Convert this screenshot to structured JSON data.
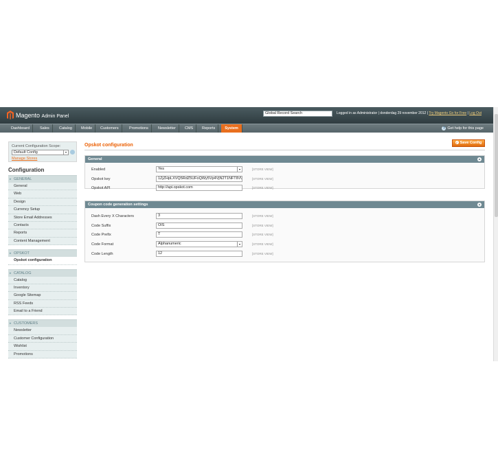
{
  "header": {
    "logo_text": "Magento",
    "panel_text": "Admin Panel",
    "search_value": "Global Record Search",
    "logged_in": "Logged in as Administrator",
    "date": "donderdag 29 november 2012",
    "try_go": "Try Magento Go for Free",
    "logout": "Log Out",
    "sep": "|"
  },
  "nav": {
    "items": [
      "Dashboard",
      "Sales",
      "Catalog",
      "Mobile",
      "Customers",
      "Promotions",
      "Newsletter",
      "CMS",
      "Reports",
      "System"
    ],
    "active": "System",
    "help": "Get help for this page"
  },
  "scope": {
    "label": "Current Configuration Scope:",
    "value": "Default Config",
    "manage": "Manage Stores"
  },
  "sidebar": {
    "title": "Configuration",
    "sections": [
      {
        "title": "GENERAL",
        "items": [
          "General",
          "Web",
          "Design",
          "Currency Setup",
          "Store Email Addresses",
          "Contacts",
          "Reports",
          "Content Management"
        ]
      },
      {
        "title": "OPSKOT",
        "items": [
          "Opskot configuration"
        ]
      },
      {
        "title": "CATALOG",
        "items": [
          "Catalog",
          "Inventory",
          "Google Sitemap",
          "RSS Feeds",
          "Email to a Friend"
        ]
      },
      {
        "title": "CUSTOMERS",
        "items": [
          "Newsletter",
          "Customer Configuration",
          "Wishlist",
          "Promotions"
        ]
      }
    ],
    "active_item": "Opskot configuration"
  },
  "main": {
    "title": "Opskot configuration",
    "save_label": "Save Config",
    "fieldsets": [
      {
        "title": "General",
        "rows": [
          {
            "label": "Enabled",
            "value": "Yes",
            "type": "select",
            "scope": "[STORE VIEW]"
          },
          {
            "label": "Opskot key",
            "value": "1ZjZHpLXVQ5RdZ5UFoQWy5Vp4VjN2T1NFTlIVUl",
            "type": "text",
            "scope": "[STORE VIEW]"
          },
          {
            "label": "Opskot API",
            "value": "http://api.opskot.com",
            "type": "text",
            "scope": "[STORE VIEW]"
          }
        ]
      },
      {
        "title": "Coupon code generation settings",
        "rows": [
          {
            "label": "Dash Every X Characters",
            "value": "3",
            "type": "text",
            "scope": "[STORE VIEW]"
          },
          {
            "label": "Code Suffix",
            "value": "OIS",
            "type": "text",
            "scope": "[STORE VIEW]"
          },
          {
            "label": "Code Prefix",
            "value": "T",
            "type": "text",
            "scope": "[STORE VIEW]"
          },
          {
            "label": "Code Format",
            "value": "Alphanumeric",
            "type": "select",
            "scope": "[STORE VIEW]"
          },
          {
            "label": "Code Length",
            "value": "12",
            "type": "text",
            "scope": "[STORE VIEW]"
          }
        ]
      }
    ]
  },
  "colors": {
    "accent": "#e96f1e",
    "header_bg": "#2f3c40",
    "fieldset_header": "#6f8992",
    "sidebar_bg": "#e7efef"
  }
}
